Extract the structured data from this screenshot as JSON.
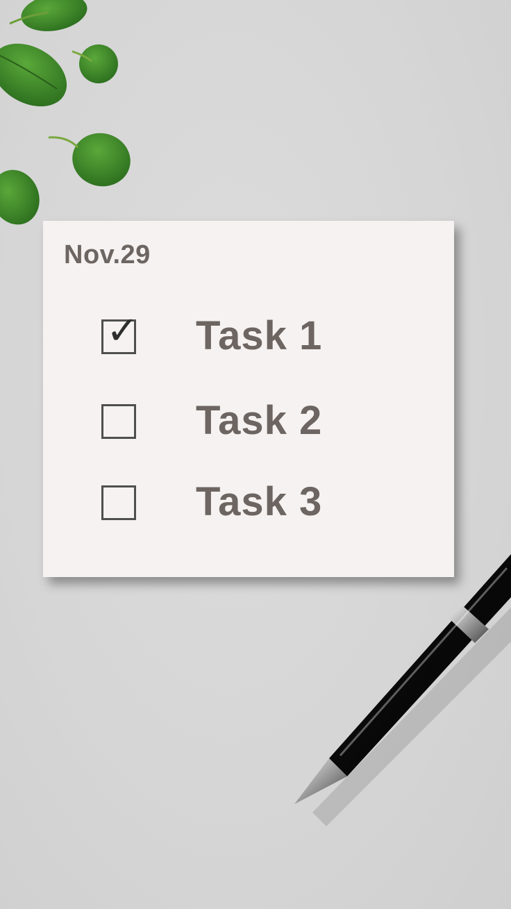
{
  "note": {
    "date": "Nov.29",
    "tasks": [
      {
        "label": "Task 1",
        "checked": true
      },
      {
        "label": "Task 2",
        "checked": false
      },
      {
        "label": "Task 3",
        "checked": false
      }
    ],
    "check_glyph": "✓"
  },
  "decor": {
    "leaf_color": "#3f8a2a",
    "pen_color": "#0b0b0b"
  }
}
